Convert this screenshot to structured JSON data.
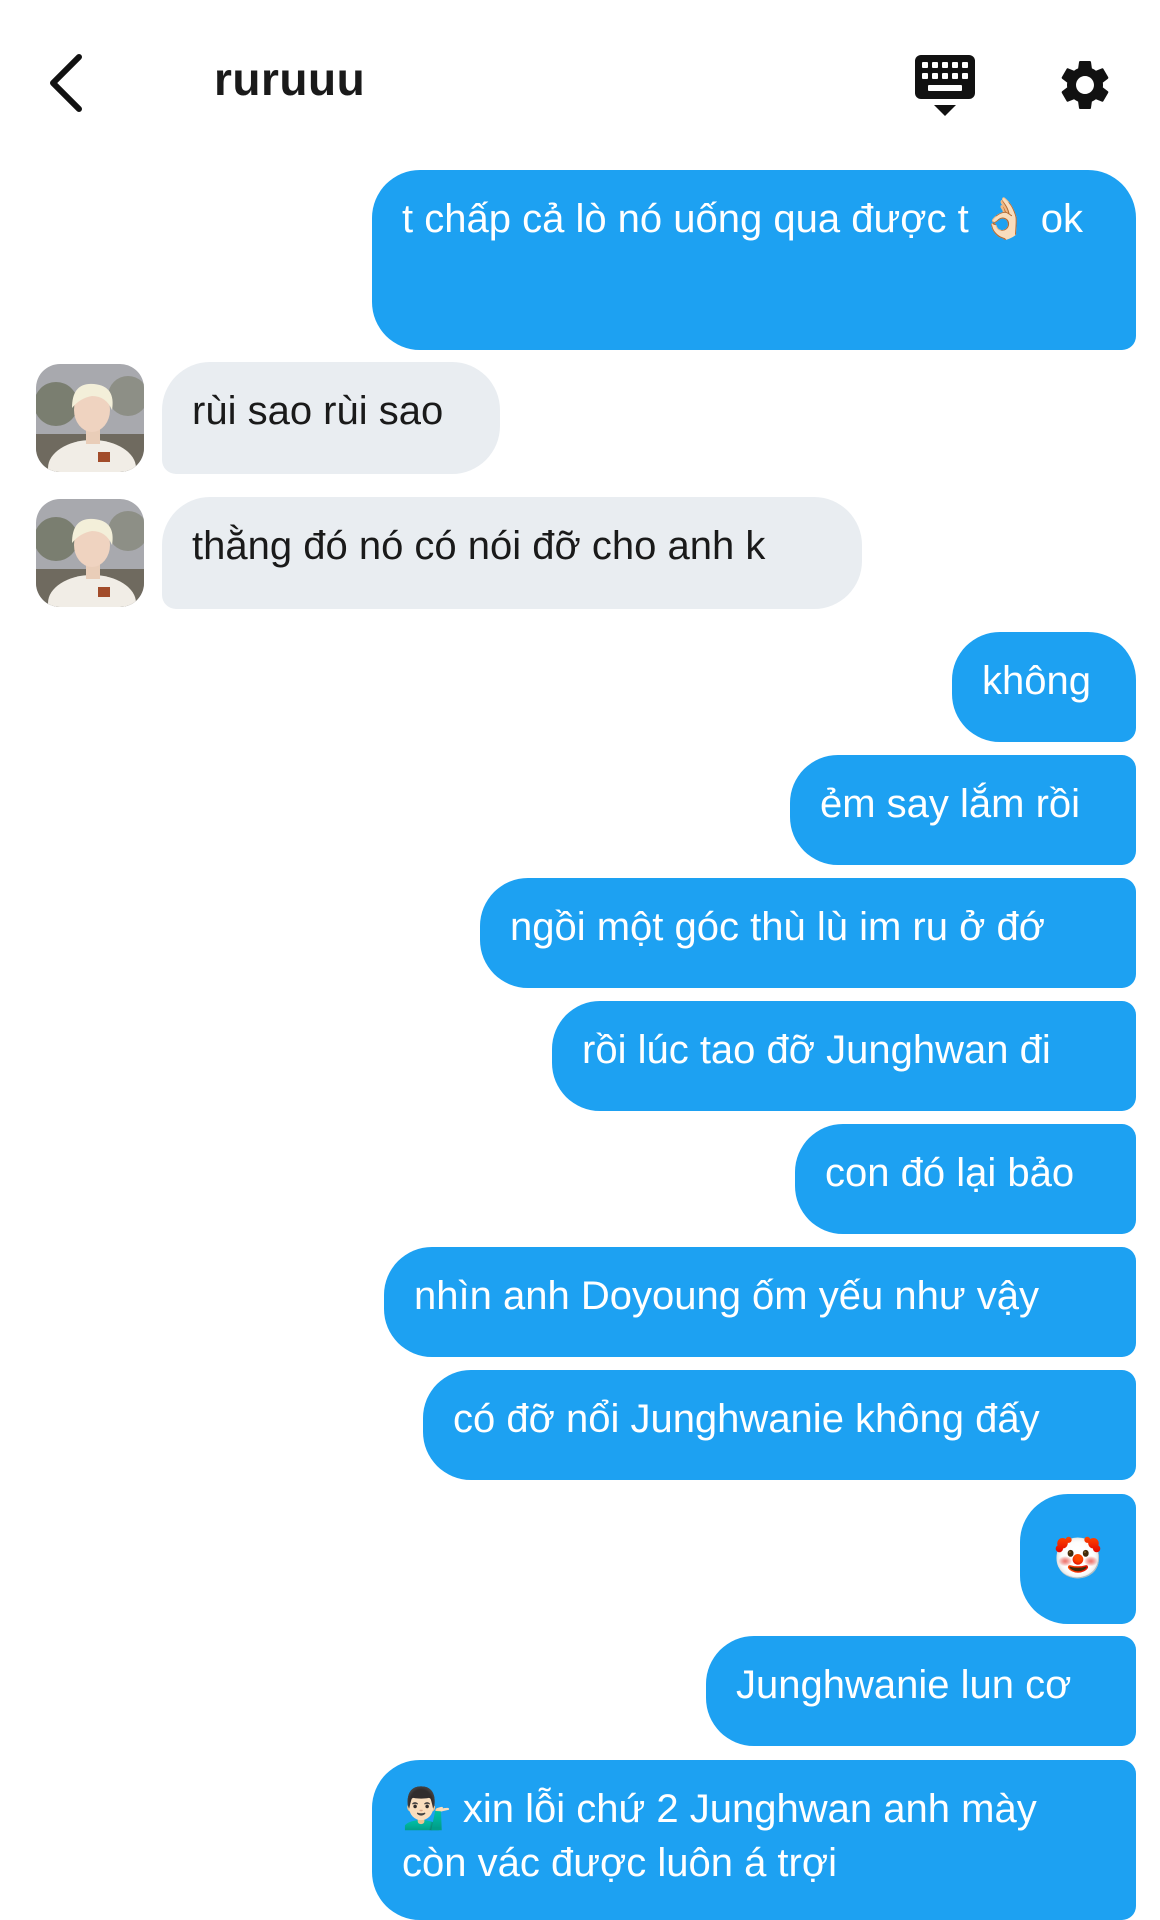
{
  "header": {
    "title": "ruruuu",
    "icons": [
      "back-arrow-icon",
      "keyboard-icon",
      "gear-icon"
    ]
  },
  "contact": {
    "avatar_icon": "profile-avatar"
  },
  "colors": {
    "outgoing_bubble": "#1da1f2",
    "incoming_bubble": "#e9edf1",
    "outgoing_text": "#ffffff",
    "incoming_text": "#1a1a1a"
  },
  "messages": [
    {
      "dir": "out",
      "text": "t chấp cả lò nó uống qua được t 👌🏻 ok"
    },
    {
      "dir": "in",
      "text": "rùi sao rùi sao"
    },
    {
      "dir": "in",
      "text": "thằng đó nó có nói đỡ cho anh k"
    },
    {
      "dir": "out",
      "text": "không"
    },
    {
      "dir": "out",
      "text": "ẻm say lắm rồi"
    },
    {
      "dir": "out",
      "text": "ngồi một góc thù lù im ru ở đớ"
    },
    {
      "dir": "out",
      "text": "rồi lúc tao đỡ Junghwan đi"
    },
    {
      "dir": "out",
      "text": "con đó lại bảo"
    },
    {
      "dir": "out",
      "text": "nhìn anh Doyoung ốm yếu như vậy"
    },
    {
      "dir": "out",
      "text": "có đỡ nổi Junghwanie không đấy"
    },
    {
      "dir": "out",
      "text": "🤡"
    },
    {
      "dir": "out",
      "text": "Junghwanie lun cơ"
    },
    {
      "dir": "out",
      "text": "💁🏻‍♂️ xin lỗi chứ 2 Junghwan anh mày còn vác được luôn á trợi"
    }
  ]
}
